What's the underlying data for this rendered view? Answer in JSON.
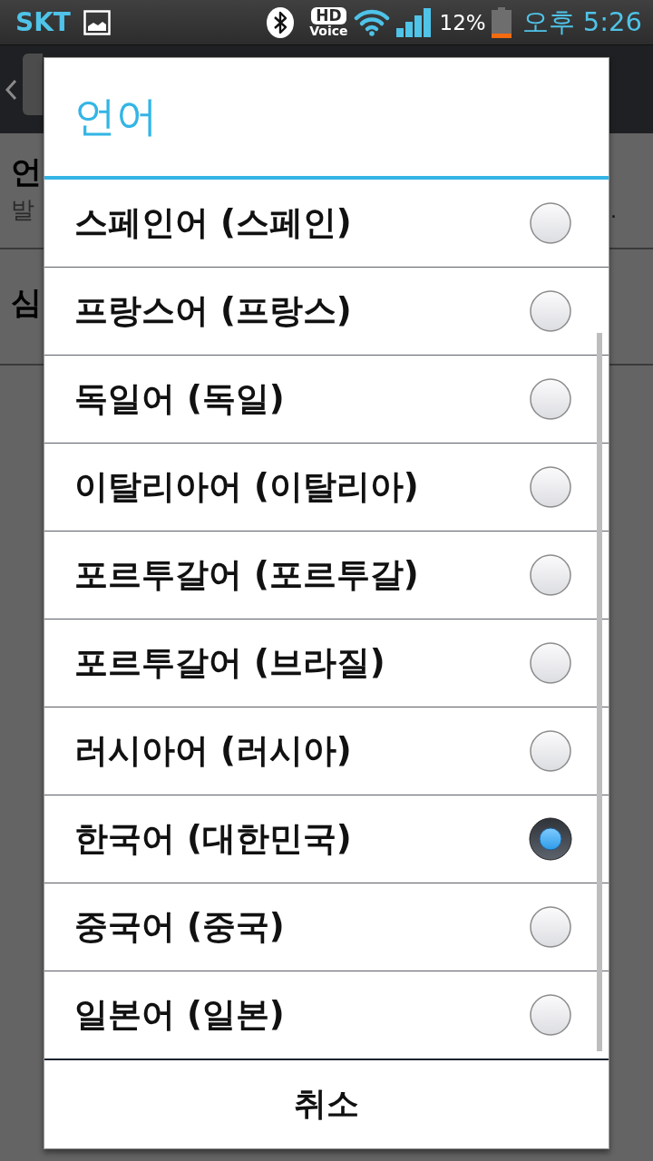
{
  "status_bar": {
    "carrier": "SKT",
    "hd_voice": {
      "top": "HD",
      "bottom": "Voice"
    },
    "battery": "12%",
    "time": "오후 5:26"
  },
  "background": {
    "rows": [
      {
        "title": "언",
        "summary": "발",
        "trailing": "."
      },
      {
        "title": "심"
      }
    ]
  },
  "dialog": {
    "title": "언어",
    "options": [
      {
        "label": "스페인어 (스페인)",
        "selected": false
      },
      {
        "label": "프랑스어 (프랑스)",
        "selected": false
      },
      {
        "label": "독일어 (독일)",
        "selected": false
      },
      {
        "label": "이탈리아어 (이탈리아)",
        "selected": false
      },
      {
        "label": "포르투갈어 (포르투갈)",
        "selected": false
      },
      {
        "label": "포르투갈어 (브라질)",
        "selected": false
      },
      {
        "label": "러시아어 (러시아)",
        "selected": false
      },
      {
        "label": "한국어 (대한민국)",
        "selected": true
      },
      {
        "label": "중국어 (중국)",
        "selected": false
      },
      {
        "label": "일본어 (일본)",
        "selected": false
      }
    ],
    "buttons": [
      "취소"
    ]
  }
}
